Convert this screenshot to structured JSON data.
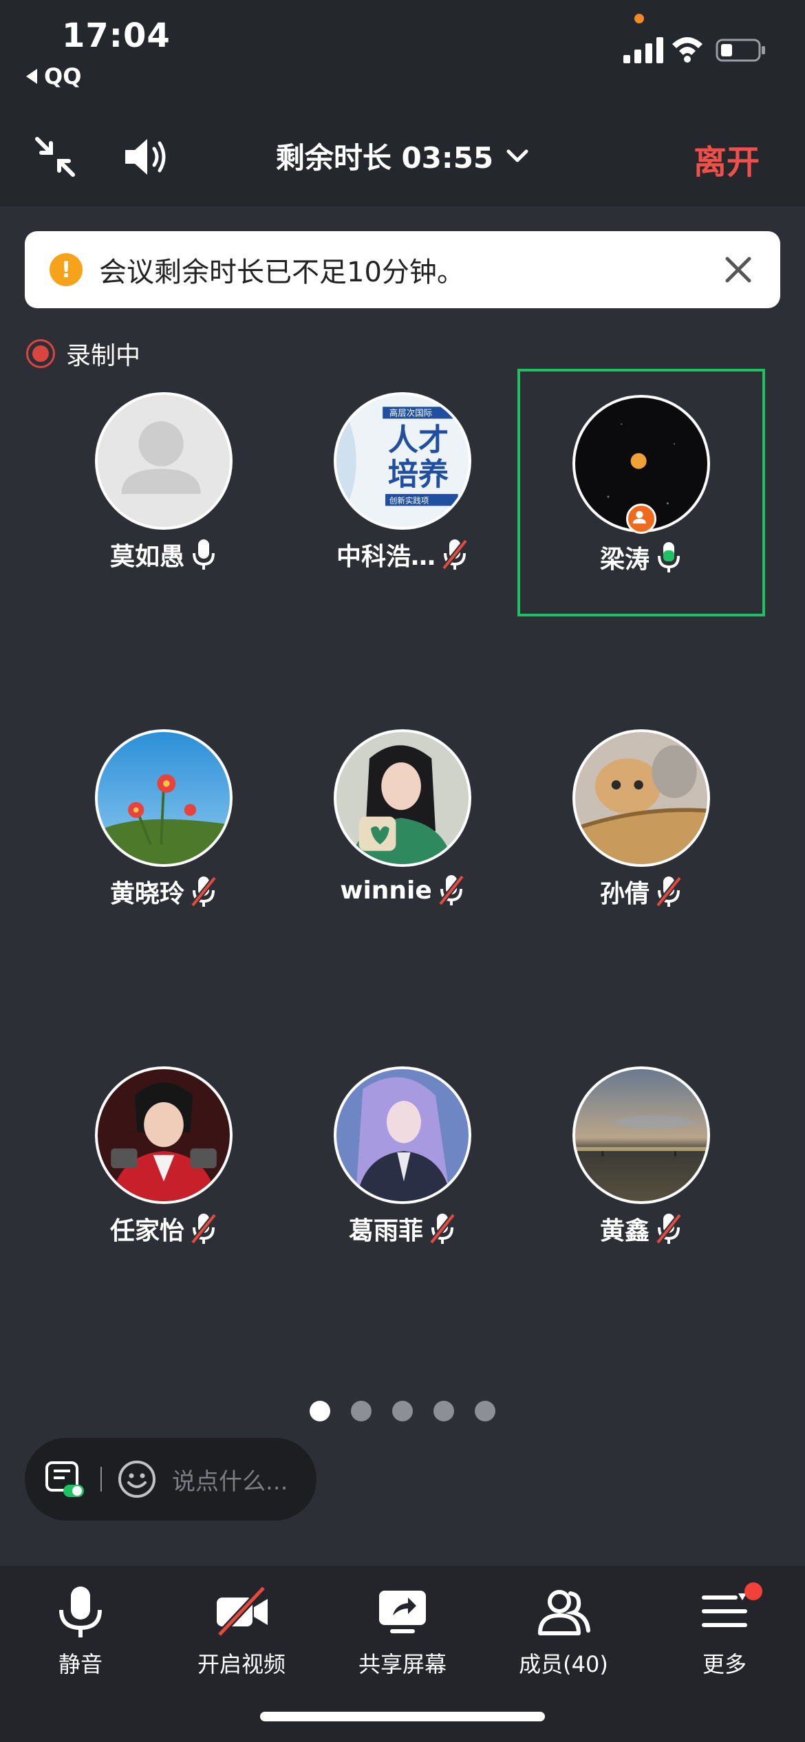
{
  "status_bar": {
    "time": "17:04",
    "back_app": "QQ"
  },
  "header": {
    "remaining": "剩余时长 03:55",
    "leave": "离开"
  },
  "notice": {
    "message": "会议剩余时长已不足10分钟。"
  },
  "recording": {
    "label": "录制中"
  },
  "participants": [
    {
      "name": "莫如愚",
      "mic": "on"
    },
    {
      "name": "中科浩…",
      "mic": "muted"
    },
    {
      "name": "梁涛",
      "mic": "speaking",
      "host": true,
      "active": true
    },
    {
      "name": "黄晓玲",
      "mic": "muted"
    },
    {
      "name": "winnie",
      "mic": "muted"
    },
    {
      "name": "孙倩",
      "mic": "muted"
    },
    {
      "name": "任家怡",
      "mic": "muted"
    },
    {
      "name": "葛雨菲",
      "mic": "muted"
    },
    {
      "name": "黄鑫",
      "mic": "muted"
    }
  ],
  "avatar_thumb_text": {
    "line1": "高层次国际",
    "line2": "人才",
    "line3": "培养",
    "line4": "创新实践项"
  },
  "pager": {
    "pages": 5,
    "current": 1
  },
  "chat": {
    "placeholder": "说点什么..."
  },
  "toolbar": {
    "mute": "静音",
    "video": "开启视频",
    "share": "共享屏幕",
    "members": "成员(40)",
    "more": "更多"
  },
  "colors": {
    "accent_green": "#1fc162",
    "leave_red": "#f0504a",
    "warning": "#f7a21b"
  }
}
